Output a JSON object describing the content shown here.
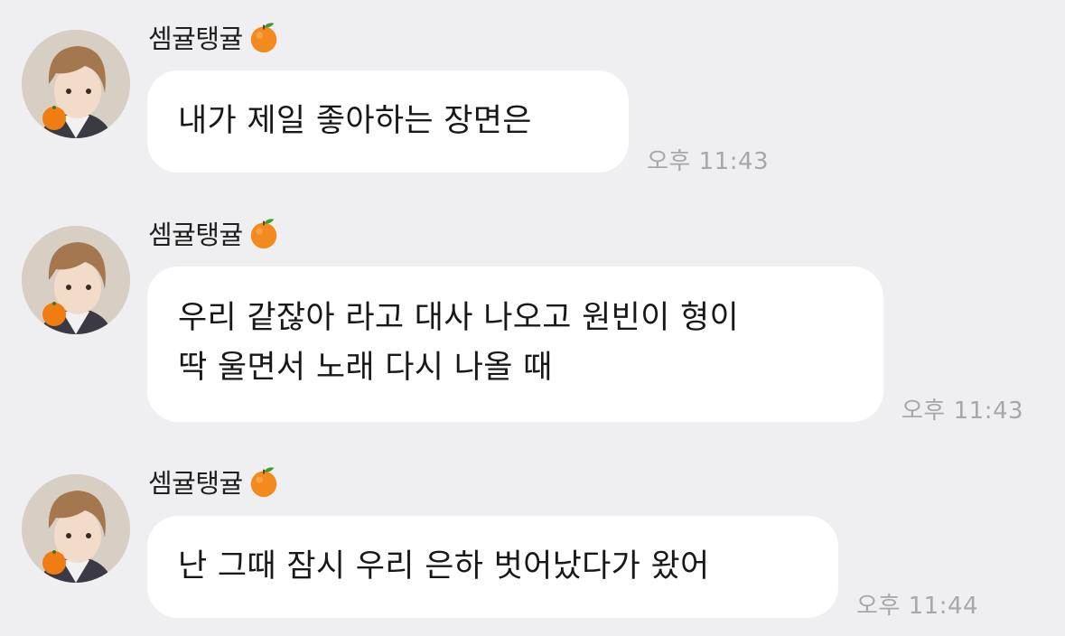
{
  "chat": {
    "messages": [
      {
        "sender": "셈귤탱귤",
        "sender_emoji": "orange-emoji",
        "lines": [
          "내가 제일 좋아하는 장면은"
        ],
        "time": "오후 11:43"
      },
      {
        "sender": "셈귤탱귤",
        "sender_emoji": "orange-emoji",
        "lines": [
          "우리 같잖아 라고 대사 나오고 원빈이 형이",
          "딱 울면서 노래 다시 나올 때"
        ],
        "time": "오후 11:43"
      },
      {
        "sender": "셈귤탱귤",
        "sender_emoji": "orange-emoji",
        "lines": [
          "난 그때 잠시 우리 은하 벗어났다가 왔어"
        ],
        "time": "오후 11:44"
      }
    ]
  },
  "colors": {
    "background": "#efeff1",
    "bubble": "#ffffff",
    "timestamp": "#a7a7a9"
  }
}
